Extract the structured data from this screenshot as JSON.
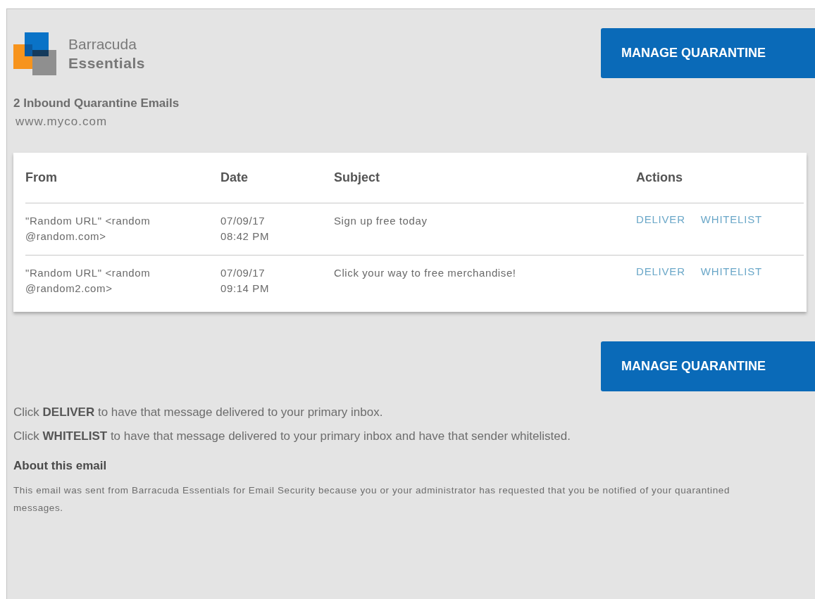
{
  "brand": {
    "line1": "Barracuda",
    "line2": "Essentials"
  },
  "manage_button_top": "MANAGE QUARANTINE",
  "heading": "2 Inbound Quarantine Emails",
  "domain": "www.myco.com",
  "table": {
    "columns": [
      "From",
      "Date",
      "Subject",
      "Actions"
    ],
    "rows": [
      {
        "from": "\"Random URL\" <random\n@random.com>",
        "date": "07/09/17\n08:42 PM",
        "subject": "Sign up free today",
        "actions": [
          "DELIVER",
          "WHITELIST"
        ]
      },
      {
        "from": "\"Random URL\" <random\n @random2.com>",
        "date": "07/09/17\n09:14 PM",
        "subject": "Click your way to free merchandise!",
        "actions": [
          "DELIVER",
          "WHITELIST"
        ]
      }
    ]
  },
  "manage_button_bottom": "MANAGE QUARANTINE",
  "instructions": [
    "Click **DELIVER** to have that message delivered to your primary inbox.",
    "Click **WHITELIST** to have that message delivered to your primary inbox and have that sender whitelisted."
  ],
  "about": {
    "title": "About this email",
    "text": "This email was sent from Barracuda Essentials for Email Security because you or your administrator has requested that you be notified of your quarantined messages."
  }
}
